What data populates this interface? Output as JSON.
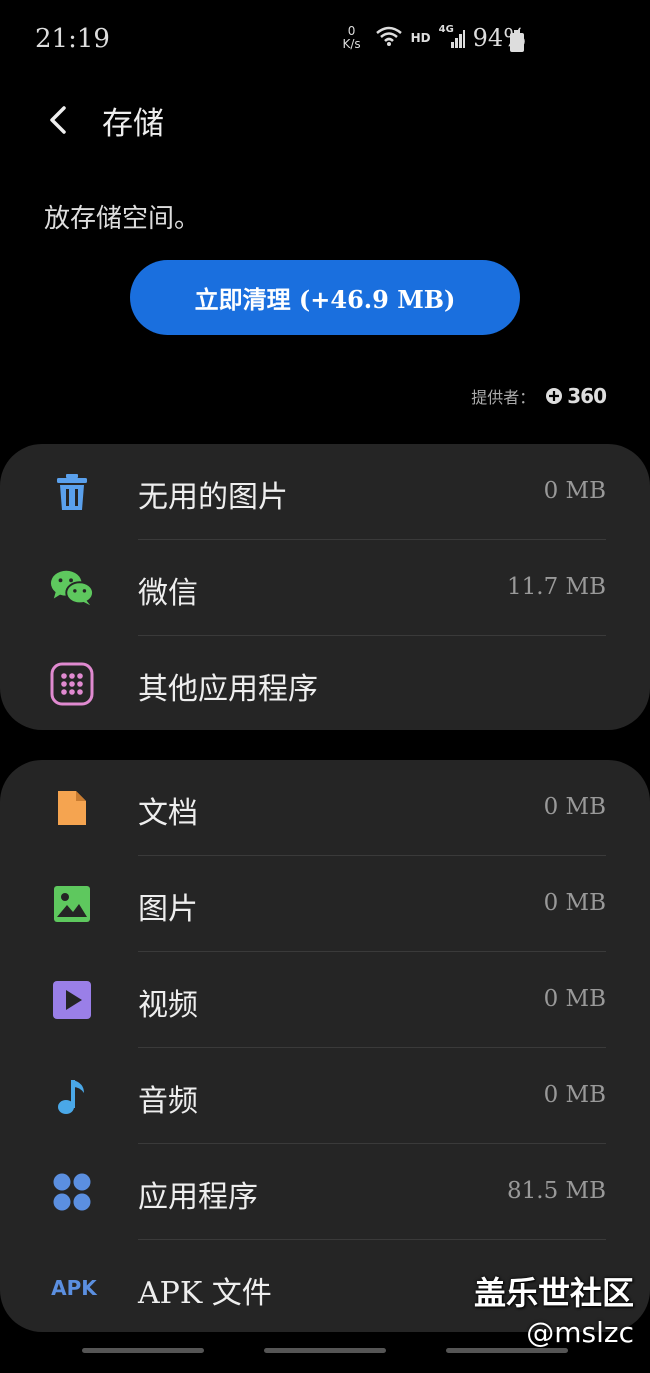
{
  "status": {
    "time": "21:19",
    "net_speed_value": "0",
    "net_speed_unit": "K/s",
    "hd": "HD",
    "network": "4G",
    "battery": "94%"
  },
  "header": {
    "title": "存储",
    "back_icon": "chevron-left-icon"
  },
  "description": "放存储空间。",
  "clean_button": {
    "label": "立即清理 (+46.9 MB)",
    "color": "#1a6fde"
  },
  "provider": {
    "label": "提供者：",
    "logo": "360"
  },
  "group1": [
    {
      "icon": "trash-icon",
      "label": "无用的图片",
      "value": "0 MB",
      "color": "#5aa0ec"
    },
    {
      "icon": "wechat-icon",
      "label": "微信",
      "value": "11.7 MB",
      "color": "#5ec85e"
    },
    {
      "icon": "apps-grid-icon",
      "label": "其他应用程序",
      "value": "",
      "color": "#e08ad0"
    }
  ],
  "group2": [
    {
      "icon": "document-icon",
      "label": "文档",
      "value": "0 MB",
      "color": "#f5a450"
    },
    {
      "icon": "image-icon",
      "label": "图片",
      "value": "0 MB",
      "color": "#5ec85e"
    },
    {
      "icon": "video-icon",
      "label": "视频",
      "value": "0 MB",
      "color": "#9a7fe8"
    },
    {
      "icon": "music-note-icon",
      "label": "音频",
      "value": "0 MB",
      "color": "#4aa8e8"
    },
    {
      "icon": "apps-icon",
      "label": "应用程序",
      "value": "81.5 MB",
      "color": "#5b8fe0"
    },
    {
      "icon": "apk-icon",
      "label": "APK 文件",
      "value": "",
      "icon_text": "APK",
      "color": "#5b8fe0"
    }
  ],
  "watermark": {
    "line1": "盖乐世社区",
    "line2": "@mslzc"
  }
}
